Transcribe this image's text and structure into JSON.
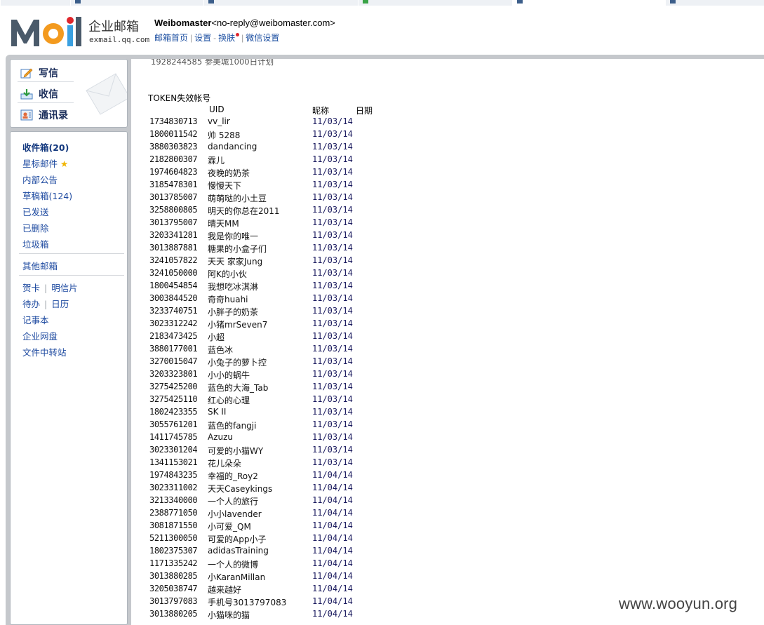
{
  "brand": {
    "logo_text": "企业邮箱",
    "logo_domain": "exmail.qq.com",
    "colors": {
      "m": "#4a5a6a",
      "o": "#f39a1e",
      "i": "#3aa0e0",
      "l": "#4a5a6a",
      "link": "#1e50a2"
    }
  },
  "account": {
    "name": "Weibomaster",
    "email": "<no-reply@weibomaster.com>",
    "links": [
      "邮箱首页",
      "设置",
      "换肤",
      "微信设置"
    ]
  },
  "compose": {
    "write": "写信",
    "receive": "收信",
    "contacts": "通讯录"
  },
  "folders": {
    "inbox": "收件箱(20)",
    "starred": "星标邮件",
    "notice": "内部公告",
    "drafts": "草稿箱(124)",
    "sent": "已发送",
    "deleted": "已删除",
    "spam": "垃圾箱",
    "other": "其他邮箱",
    "card": "贺卡",
    "postcard": "明信片",
    "todo": "待办",
    "calendar": "日历",
    "notes": "记事本",
    "disk": "企业网盘",
    "transfer": "文件中转站"
  },
  "content": {
    "cut_line": "1928244585 参美城1000日计划",
    "section_title": "TOKEN失效帐号",
    "col_uid": "UID",
    "col_nick": "昵称",
    "col_date": "日期",
    "rows": [
      {
        "uid": "1734830713",
        "nick": "vv_lir",
        "date": "11/03/14"
      },
      {
        "uid": "1800011542",
        "nick": "帅 5288",
        "date": "11/03/14"
      },
      {
        "uid": "3880303823",
        "nick": "dandancing",
        "date": "11/03/14"
      },
      {
        "uid": "2182800307",
        "nick": "霖儿",
        "date": "11/03/14"
      },
      {
        "uid": "1974604823",
        "nick": "夜晚的奶茶",
        "date": "11/03/14"
      },
      {
        "uid": "3185478301",
        "nick": "慢慢天下",
        "date": "11/03/14"
      },
      {
        "uid": "3013785007",
        "nick": "萌萌哒的小土豆",
        "date": "11/03/14"
      },
      {
        "uid": "3258800805",
        "nick": "明天的你总在2011",
        "date": "11/03/14"
      },
      {
        "uid": "3013795007",
        "nick": "晴天MM",
        "date": "11/03/14"
      },
      {
        "uid": "3203341281",
        "nick": "我是你的唯一",
        "date": "11/03/14"
      },
      {
        "uid": "3013887881",
        "nick": "糖果的小盒子们",
        "date": "11/03/14"
      },
      {
        "uid": "3241057822",
        "nick": "天天 家家Jung",
        "date": "11/03/14"
      },
      {
        "uid": "3241050000",
        "nick": "阿K的小伙",
        "date": "11/03/14"
      },
      {
        "uid": "1800454854",
        "nick": "我想吃冰淇淋",
        "date": "11/03/14"
      },
      {
        "uid": "3003844520",
        "nick": "奇奇huahi",
        "date": "11/03/14"
      },
      {
        "uid": "3233740751",
        "nick": "小胖子的奶茶",
        "date": "11/03/14"
      },
      {
        "uid": "3023312242",
        "nick": "小猪mrSeven7",
        "date": "11/03/14"
      },
      {
        "uid": "2183473425",
        "nick": "小超",
        "date": "11/03/14"
      },
      {
        "uid": "3880177001",
        "nick": "蓝色冰",
        "date": "11/03/14"
      },
      {
        "uid": "3270015047",
        "nick": "小兔子的萝卜控",
        "date": "11/03/14"
      },
      {
        "uid": "3203323801",
        "nick": "小小的蜗牛",
        "date": "11/03/14"
      },
      {
        "uid": "3275425200",
        "nick": "蓝色的大海_Tab",
        "date": "11/03/14"
      },
      {
        "uid": "3275425110",
        "nick": "红心的心理",
        "date": "11/03/14"
      },
      {
        "uid": "1802423355",
        "nick": "SK II",
        "date": "11/03/14"
      },
      {
        "uid": "3055761201",
        "nick": "蓝色的fangji",
        "date": "11/03/14"
      },
      {
        "uid": "1411745785",
        "nick": "Azuzu",
        "date": "11/03/14"
      },
      {
        "uid": "3023301204",
        "nick": "可爱的小猫WY",
        "date": "11/03/14"
      },
      {
        "uid": "1341153021",
        "nick": "花儿朵朵",
        "date": "11/03/14"
      },
      {
        "uid": "1974843235",
        "nick": "幸福的_Roy2",
        "date": "11/04/14"
      },
      {
        "uid": "3023311002",
        "nick": "天天Caseykings",
        "date": "11/04/14"
      },
      {
        "uid": "3213340000",
        "nick": "一个人的旅行",
        "date": "11/04/14"
      },
      {
        "uid": "2388771050",
        "nick": "小小lavender",
        "date": "11/04/14"
      },
      {
        "uid": "3081871550",
        "nick": "小可爱_QM",
        "date": "11/04/14"
      },
      {
        "uid": "5211300050",
        "nick": "可爱的App小子",
        "date": "11/04/14"
      },
      {
        "uid": "1802375307",
        "nick": "adidasTraining",
        "date": "11/04/14"
      },
      {
        "uid": "1171335242",
        "nick": "一个人的微博",
        "date": "11/04/14"
      },
      {
        "uid": "3013880285",
        "nick": "小KaranMillan",
        "date": "11/04/14"
      },
      {
        "uid": "3205038747",
        "nick": "越来越好",
        "date": "11/04/14"
      },
      {
        "uid": "3013797083",
        "nick": "手机号3013797083",
        "date": "11/04/14"
      },
      {
        "uid": "3013880205",
        "nick": "小猫咪的猫",
        "date": "11/04/14"
      }
    ]
  },
  "watermark": "www.wooyun.org"
}
